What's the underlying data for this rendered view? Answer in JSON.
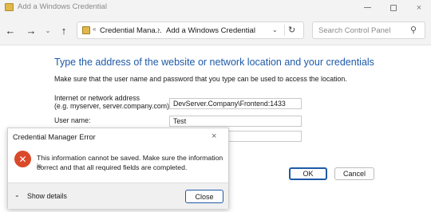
{
  "window": {
    "title": "Add a Windows Credential",
    "controls": {
      "minimize": "minimize-icon",
      "maximize": "maximize-icon",
      "close": "×"
    }
  },
  "toolbar": {
    "back_glyph": "←",
    "forward_glyph": "→",
    "history_glyph": "⌄",
    "up_glyph": "↑",
    "breadcrumb": [
      "Credential Mana...",
      "Add a Windows Credential"
    ],
    "dropdown_glyph": "⌄",
    "refresh_glyph": "↻",
    "search_placeholder": "Search Control Panel",
    "search_glyph": "⚲"
  },
  "main": {
    "heading": "Type the address of the website or network location and your credentials",
    "subtitle": "Make sure that the user name and password that you type can be used to access the location.",
    "address_label_line1": "Internet or network address",
    "address_label_line2": "(e.g. myserver, server.company.com):",
    "address_value": "DevServer.Company\\Frontend:1433",
    "username_label": "User name:",
    "username_value": "Test",
    "password_value": "",
    "ok_label": "OK",
    "cancel_label": "Cancel"
  },
  "error_dialog": {
    "title": "Credential Manager Error",
    "close_glyph": "×",
    "icon_glyph": "✕",
    "message_line1": "This information cannot be saved. Make sure the information is",
    "message_line2": "correct and that all required fields are completed.",
    "details_chevron": "⌄",
    "show_details_label": "Show details",
    "close_button_label": "Close"
  },
  "colors": {
    "accent": "#1e5aa8",
    "error_icon": "#d94a2a",
    "titlebar": "#f3f3f3"
  }
}
